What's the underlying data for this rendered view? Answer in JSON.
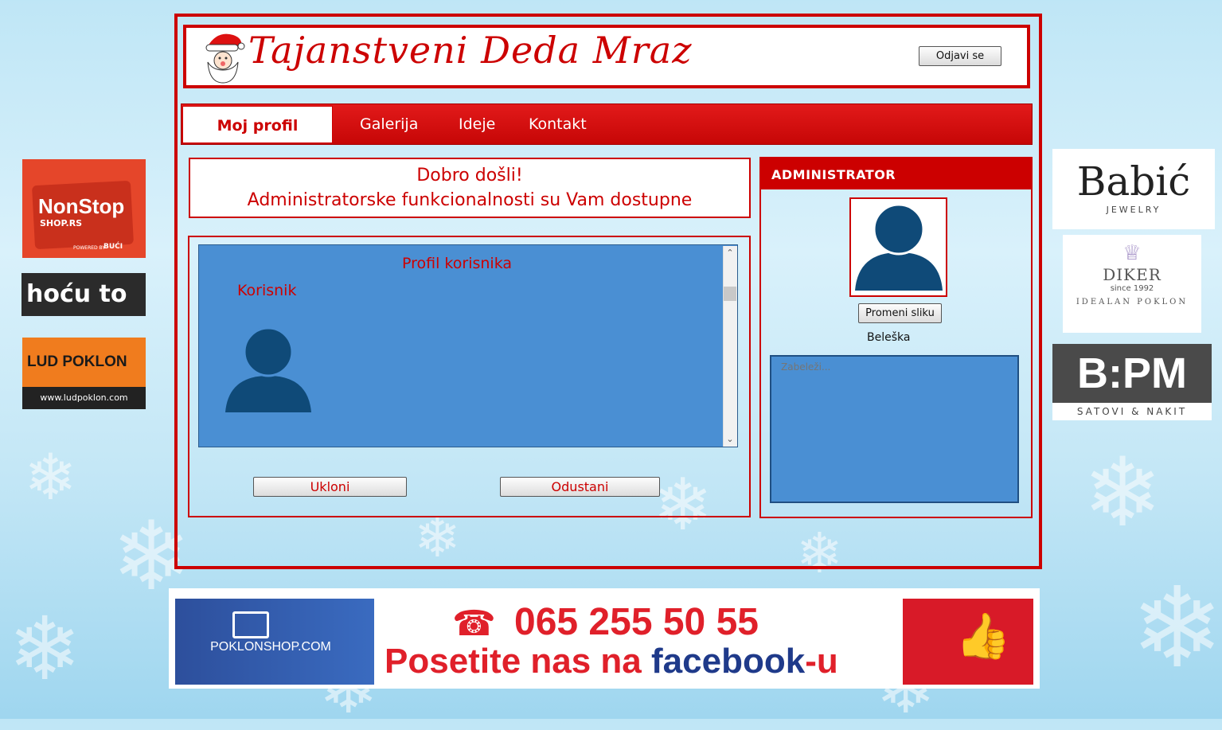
{
  "header": {
    "logo_text": "Tajanstveni Deda Mraz",
    "logout_label": "Odjavi se"
  },
  "nav": {
    "items": [
      {
        "label": "Moj profil",
        "active": true
      },
      {
        "label": "Galerija"
      },
      {
        "label": "Ideje"
      },
      {
        "label": "Kontakt"
      }
    ]
  },
  "welcome": {
    "line1": "Dobro došli!",
    "line2": "Administratorske funkcionalnosti su Vam dostupne"
  },
  "profile": {
    "title": "Profil korisnika",
    "user_label": "Korisnik",
    "remove_label": "Ukloni",
    "cancel_label": "Odustani"
  },
  "admin": {
    "title": "ADMINISTRATOR",
    "change_photo_label": "Promeni sliku",
    "note_label": "Beleška",
    "note_placeholder": "Zabeleži..."
  },
  "ads": {
    "nonstop": {
      "line1": "NonStop",
      "line2": "SHOP.RS",
      "line3": "POWERED BY",
      "line4": "BUĆI"
    },
    "hocu": "hoću to",
    "lud": {
      "line1": "LUD POKLON",
      "line2": "www.ludpoklon.com"
    },
    "babic": {
      "name": "Babić",
      "sub": "JEWELRY"
    },
    "diker": {
      "name": "DIKER",
      "since": "since 1992",
      "tag": "IDEALAN POKLON"
    },
    "bpm": {
      "name": "B:PM",
      "sub": "SATOVI & NAKIT"
    }
  },
  "banner": {
    "shop": "POKLONSHOP.COM",
    "phone": "065 255 50 55",
    "text_prefix": "Posetite nas na ",
    "text_brand": "facebook",
    "text_suffix": "-u"
  },
  "colors": {
    "accent": "#cc0000",
    "panel_blue": "#4a8fd3",
    "avatar": "#0f4a78"
  }
}
